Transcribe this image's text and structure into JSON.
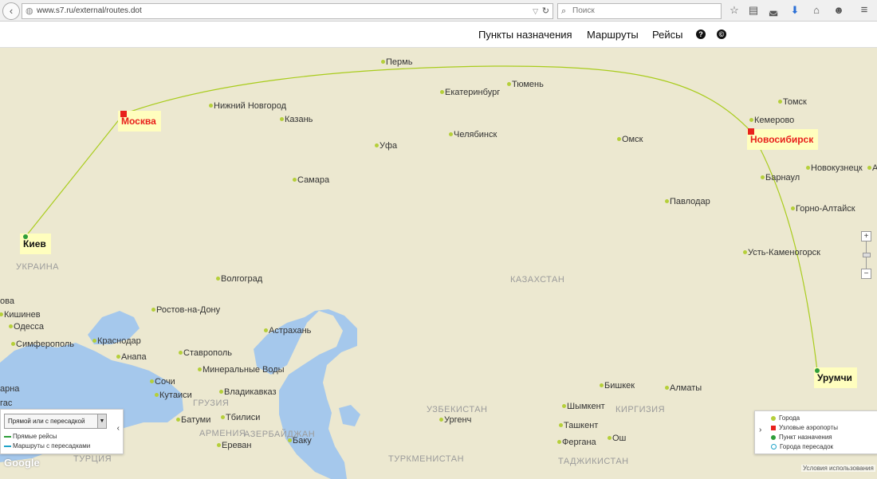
{
  "browser": {
    "url": "www.s7.ru/external/routes.dot",
    "search_placeholder": "Поиск",
    "icons": [
      "back-icon",
      "globe-icon",
      "dropdown-icon",
      "reload-icon",
      "search-icon",
      "bookmark-star-icon",
      "reading-list-icon",
      "pocket-icon",
      "download-icon",
      "home-icon",
      "chat-icon",
      "menu-icon"
    ]
  },
  "nav": {
    "destinations": "Пункты назначения",
    "routes": "Маршруты",
    "flights": "Рейсы",
    "help": "?",
    "copyright": "©"
  },
  "map": {
    "cities": [
      {
        "name": "Пермь"
      },
      {
        "name": "Екатеринбург"
      },
      {
        "name": "Тюмень"
      },
      {
        "name": "Томск"
      },
      {
        "name": "Кемерово"
      },
      {
        "name": "Нижний Новгород"
      },
      {
        "name": "Казань"
      },
      {
        "name": "Уфа"
      },
      {
        "name": "Челябинск"
      },
      {
        "name": "Омск"
      },
      {
        "name": "Новокузнецк"
      },
      {
        "name": "Барнаул"
      },
      {
        "name": "Самара"
      },
      {
        "name": "Павлодар"
      },
      {
        "name": "Горно-Алтайск"
      },
      {
        "name": "Усть-Каменогорск"
      },
      {
        "name": "Волгоград"
      },
      {
        "name": "Ростов-на-Дону"
      },
      {
        "name": "Кишинев"
      },
      {
        "name": "Одесса"
      },
      {
        "name": "Астрахань"
      },
      {
        "name": "Симферополь"
      },
      {
        "name": "Краснодар"
      },
      {
        "name": "Анапа"
      },
      {
        "name": "Ставрополь"
      },
      {
        "name": "Минеральные Воды"
      },
      {
        "name": "Сочи"
      },
      {
        "name": "Кутаиси"
      },
      {
        "name": "Владикавказ"
      },
      {
        "name": "Батуми"
      },
      {
        "name": "Тбилиси"
      },
      {
        "name": "Ереван"
      },
      {
        "name": "Баку"
      },
      {
        "name": "Ургенч"
      },
      {
        "name": "Шымкент"
      },
      {
        "name": "Ташкент"
      },
      {
        "name": "Фергана"
      },
      {
        "name": "Ош"
      },
      {
        "name": "Бишкек"
      },
      {
        "name": "Алматы"
      },
      {
        "name": "арна"
      },
      {
        "name": "гас"
      },
      {
        "name": "ова"
      },
      {
        "name": "А"
      }
    ],
    "countries": [
      {
        "name": "УКРАИНА"
      },
      {
        "name": "КАЗАХСТАН"
      },
      {
        "name": "УЗБЕКИСТАН"
      },
      {
        "name": "КИРГИЗИЯ"
      },
      {
        "name": "ГРУЗИЯ"
      },
      {
        "name": "АРМЕНИЯ"
      },
      {
        "name": "АЗЕРБАЙДЖАН"
      },
      {
        "name": "ТУРКМЕНИСТАН"
      },
      {
        "name": "ТАДЖИКИСТАН"
      },
      {
        "name": "ТУРЦИЯ"
      }
    ],
    "hubs": [
      "Москва",
      "Новосибирск"
    ],
    "destinations": [
      "Киев",
      "Урумчи"
    ],
    "colors": {
      "route": "#a9cc1c",
      "hub": "#e8211c",
      "city_dot": "#b5cf3a",
      "destination_dot": "#2e9e3a",
      "transfer": "#1fa3c8",
      "land": "#ece8d0",
      "water": "#a5c8ec"
    },
    "zoom": {
      "plus": "+",
      "minus": "−"
    }
  },
  "left_panel": {
    "select_value": "Прямой или с пересадкой",
    "legend": [
      {
        "label": "Прямые рейсы",
        "color": "#2e9e3a"
      },
      {
        "label": "Маршруты с пересадками",
        "color": "#1fa3c8"
      }
    ],
    "collapse": "‹"
  },
  "right_panel": {
    "collapse": "›",
    "legend": [
      {
        "label": "Города",
        "color": "#b5cf3a",
        "shape": "circle"
      },
      {
        "label": "Узловые аэропорты",
        "color": "#e8211c",
        "shape": "square"
      },
      {
        "label": "Пункт назначения",
        "color": "#2e9e3a",
        "shape": "circle"
      },
      {
        "label": "Города пересадок",
        "color": "#1fa3c8",
        "shape": "ring"
      }
    ]
  },
  "footer": {
    "google": "Google",
    "terms": "Условия использования"
  }
}
